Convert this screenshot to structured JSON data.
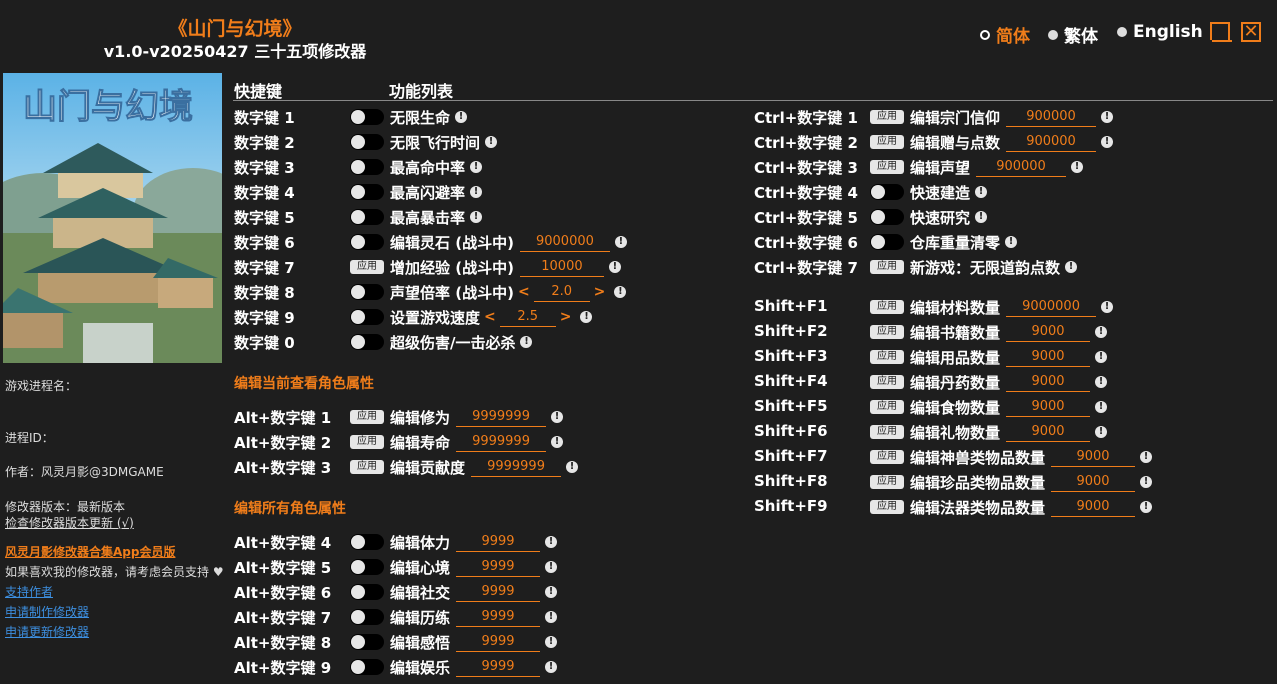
{
  "header": {
    "title": "《山门与幻境》",
    "subtitle": "v1.0-v20250427 三十五项修改器"
  },
  "languages": [
    {
      "label": "简体",
      "active": true
    },
    {
      "label": "繁体",
      "active": false
    },
    {
      "label": "English",
      "active": false
    }
  ],
  "cover": {
    "logo_text": "山门与幻境"
  },
  "sidebar": {
    "process_name_label": "游戏进程名：",
    "process_id_label": "进程ID：",
    "author": "作者：风灵月影@3DMGAME",
    "version": "修改器版本：最新版本",
    "check_update": "检查修改器版本更新 (√)",
    "app_link": "风灵月影修改器合集App会员版",
    "support_text": "如果喜欢我的修改器，请考虑会员支持 ♥",
    "support_author": "支持作者",
    "request_make": "申请制作修改器",
    "request_update": "申请更新修改器"
  },
  "columns": {
    "hotkey": "快捷键",
    "features": "功能列表"
  },
  "sections": {
    "current_char": "编辑当前查看角色属性",
    "all_chars": "编辑所有角色属性"
  },
  "apply_label": "应用",
  "left_rows": [
    {
      "key": "数字键 1",
      "type": "toggle",
      "label": "无限生命"
    },
    {
      "key": "数字键 2",
      "type": "toggle",
      "label": "无限飞行时间"
    },
    {
      "key": "数字键 3",
      "type": "toggle",
      "label": "最高命中率"
    },
    {
      "key": "数字键 4",
      "type": "toggle",
      "label": "最高闪避率"
    },
    {
      "key": "数字键 5",
      "type": "toggle",
      "label": "最高暴击率"
    },
    {
      "key": "数字键 6",
      "type": "toggle",
      "label": "编辑灵石 (战斗中)",
      "value": "9000000"
    },
    {
      "key": "数字键 7",
      "type": "apply",
      "label": "增加经验 (战斗中)",
      "value": "10000"
    },
    {
      "key": "数字键 8",
      "type": "toggle",
      "label": "声望倍率 (战斗中)",
      "stepper": "2.0"
    },
    {
      "key": "数字键 9",
      "type": "toggle",
      "label": "设置游戏速度",
      "stepper": "2.5"
    },
    {
      "key": "数字键 0",
      "type": "toggle",
      "label": "超级伤害/一击必杀"
    }
  ],
  "current_rows": [
    {
      "key": "Alt+数字键 1",
      "type": "apply",
      "label": "编辑修为",
      "value": "9999999"
    },
    {
      "key": "Alt+数字键 2",
      "type": "apply",
      "label": "编辑寿命",
      "value": "9999999"
    },
    {
      "key": "Alt+数字键 3",
      "type": "apply",
      "label": "编辑贡献度",
      "value": "9999999"
    }
  ],
  "all_rows": [
    {
      "key": "Alt+数字键 4",
      "type": "toggle",
      "label": "编辑体力",
      "value": "9999"
    },
    {
      "key": "Alt+数字键 5",
      "type": "toggle",
      "label": "编辑心境",
      "value": "9999"
    },
    {
      "key": "Alt+数字键 6",
      "type": "toggle",
      "label": "编辑社交",
      "value": "9999"
    },
    {
      "key": "Alt+数字键 7",
      "type": "toggle",
      "label": "编辑历练",
      "value": "9999"
    },
    {
      "key": "Alt+数字键 8",
      "type": "toggle",
      "label": "编辑感悟",
      "value": "9999"
    },
    {
      "key": "Alt+数字键 9",
      "type": "toggle",
      "label": "编辑娱乐",
      "value": "9999"
    }
  ],
  "ctrl_rows": [
    {
      "key": "Ctrl+数字键 1",
      "type": "apply",
      "label": "编辑宗门信仰",
      "value": "900000"
    },
    {
      "key": "Ctrl+数字键 2",
      "type": "apply",
      "label": "编辑赠与点数",
      "value": "900000"
    },
    {
      "key": "Ctrl+数字键 3",
      "type": "apply",
      "label": "编辑声望",
      "value": "900000"
    },
    {
      "key": "Ctrl+数字键 4",
      "type": "toggle",
      "label": "快速建造"
    },
    {
      "key": "Ctrl+数字键 5",
      "type": "toggle",
      "label": "快速研究"
    },
    {
      "key": "Ctrl+数字键 6",
      "type": "toggle",
      "label": "仓库重量清零"
    },
    {
      "key": "Ctrl+数字键 7",
      "type": "apply",
      "label": "新游戏：无限道韵点数"
    }
  ],
  "shift_rows": [
    {
      "key": "Shift+F1",
      "type": "apply",
      "label": "编辑材料数量",
      "value": "9000000"
    },
    {
      "key": "Shift+F2",
      "type": "apply",
      "label": "编辑书籍数量",
      "value": "9000"
    },
    {
      "key": "Shift+F3",
      "type": "apply",
      "label": "编辑用品数量",
      "value": "9000"
    },
    {
      "key": "Shift+F4",
      "type": "apply",
      "label": "编辑丹药数量",
      "value": "9000"
    },
    {
      "key": "Shift+F5",
      "type": "apply",
      "label": "编辑食物数量",
      "value": "9000"
    },
    {
      "key": "Shift+F6",
      "type": "apply",
      "label": "编辑礼物数量",
      "value": "9000"
    },
    {
      "key": "Shift+F7",
      "type": "apply",
      "label": "编辑神兽类物品数量",
      "value": "9000"
    },
    {
      "key": "Shift+F8",
      "type": "apply",
      "label": "编辑珍品类物品数量",
      "value": "9000"
    },
    {
      "key": "Shift+F9",
      "type": "apply",
      "label": "编辑法器类物品数量",
      "value": "9000"
    }
  ]
}
